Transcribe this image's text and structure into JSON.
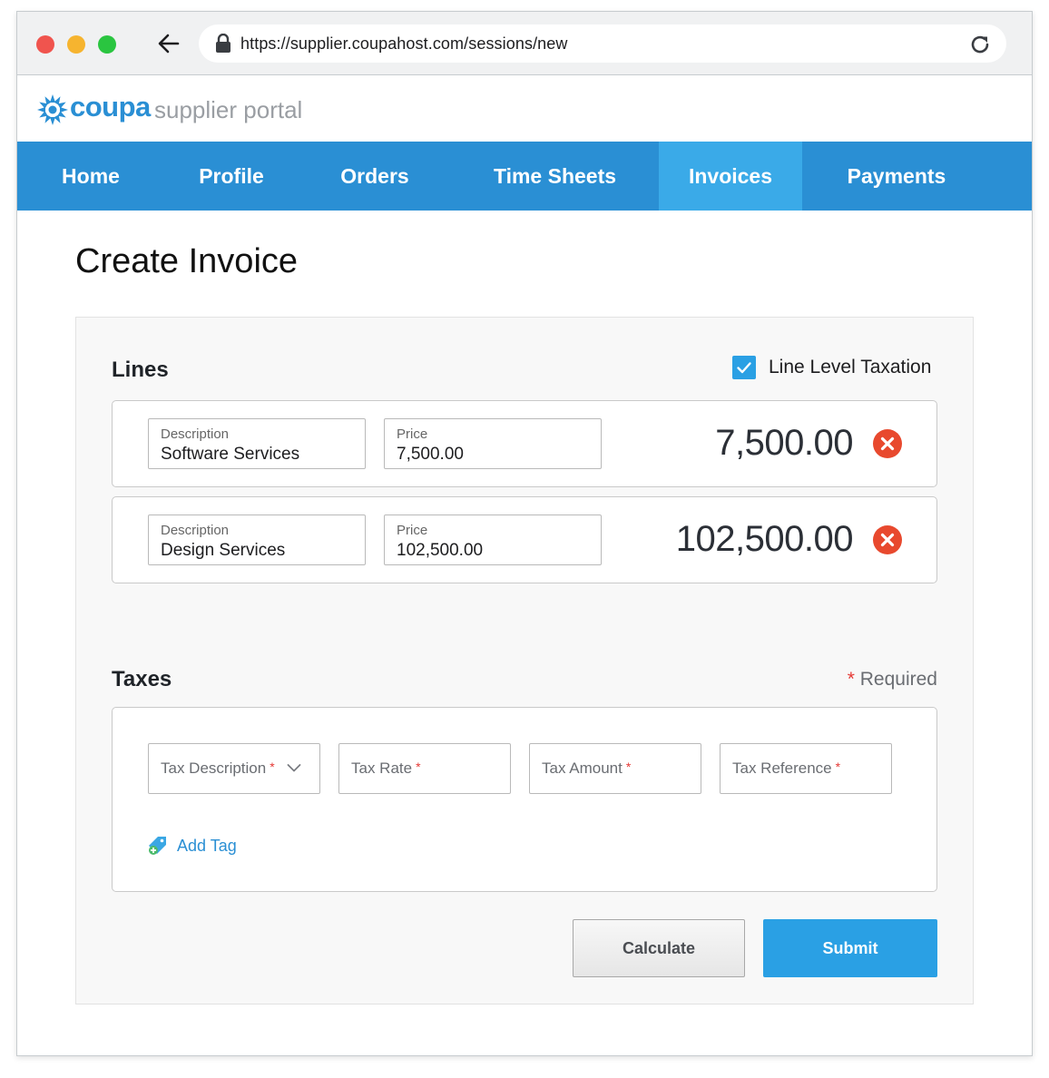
{
  "browser": {
    "url": "https://supplier.coupahost.com/sessions/new"
  },
  "brand": {
    "logo_text": "coupa",
    "subtitle": "supplier portal",
    "color": "#2a8fd4"
  },
  "nav": {
    "items": [
      {
        "label": "Home",
        "active": false
      },
      {
        "label": "Profile",
        "active": false
      },
      {
        "label": "Orders",
        "active": false
      },
      {
        "label": "Time Sheets",
        "active": false
      },
      {
        "label": "Invoices",
        "active": true
      },
      {
        "label": "Payments",
        "active": false
      }
    ],
    "bg_color": "#2a8fd4",
    "active_color": "#3aaae8"
  },
  "page": {
    "title": "Create Invoice"
  },
  "lines": {
    "title": "Lines",
    "line_level_taxation_label": "Line Level Taxation",
    "line_level_taxation_checked": true,
    "items": [
      {
        "description_label": "Description",
        "description": "Software Services",
        "price_label": "Price",
        "price": "7,500.00",
        "amount": "7,500.00"
      },
      {
        "description_label": "Description",
        "description": "Design Services",
        "price_label": "Price",
        "price": "102,500.00",
        "amount": "102,500.00"
      }
    ]
  },
  "taxes": {
    "title": "Taxes",
    "required_star": "*",
    "required_label": "Required",
    "fields": [
      {
        "label": "Tax Description",
        "type": "select"
      },
      {
        "label": "Tax Rate",
        "type": "text"
      },
      {
        "label": "Tax Amount",
        "type": "text"
      },
      {
        "label": "Tax Reference",
        "type": "text"
      }
    ],
    "required_marker": "*",
    "add_tag_label": "Add Tag"
  },
  "actions": {
    "calculate_label": "Calculate",
    "submit_label": "Submit"
  },
  "colors": {
    "accent": "#2aa0e4",
    "remove": "#e8492e",
    "required": "#e53935"
  }
}
